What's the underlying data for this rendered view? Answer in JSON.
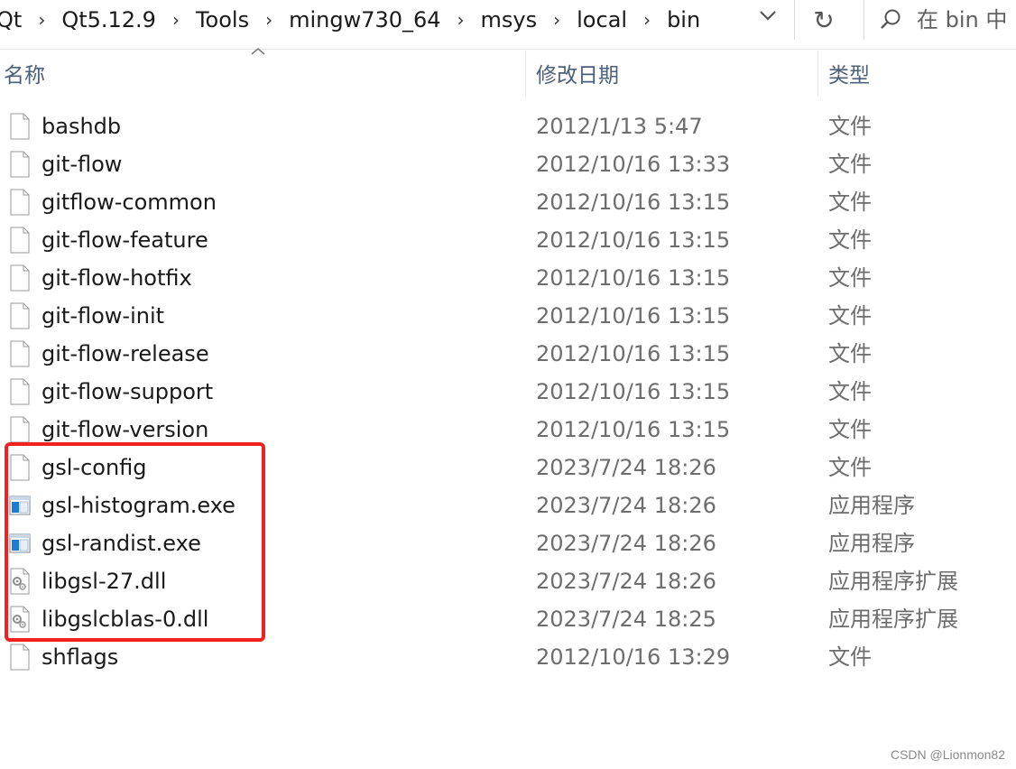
{
  "address_bar": {
    "breadcrumbs": [
      "Qt",
      "Qt5.12.9",
      "Tools",
      "mingw730_64",
      "msys",
      "local",
      "bin"
    ],
    "separator": "›"
  },
  "toolbar": {
    "history_dropdown_icon": "chevron-down-icon",
    "refresh_icon": "refresh-icon",
    "refresh_glyph": "↻"
  },
  "search": {
    "icon": "search-icon",
    "placeholder": "在 bin 中"
  },
  "columns": {
    "name": "名称",
    "date_modified": "修改日期",
    "type": "类型",
    "sort_indicator": "ascending"
  },
  "files": [
    {
      "name": "bashdb",
      "date": "2012/1/13 5:47",
      "type": "文件",
      "icon": "file"
    },
    {
      "name": "git-flow",
      "date": "2012/10/16 13:33",
      "type": "文件",
      "icon": "file"
    },
    {
      "name": "gitflow-common",
      "date": "2012/10/16 13:15",
      "type": "文件",
      "icon": "file"
    },
    {
      "name": "git-flow-feature",
      "date": "2012/10/16 13:15",
      "type": "文件",
      "icon": "file"
    },
    {
      "name": "git-flow-hotfix",
      "date": "2012/10/16 13:15",
      "type": "文件",
      "icon": "file"
    },
    {
      "name": "git-flow-init",
      "date": "2012/10/16 13:15",
      "type": "文件",
      "icon": "file"
    },
    {
      "name": "git-flow-release",
      "date": "2012/10/16 13:15",
      "type": "文件",
      "icon": "file"
    },
    {
      "name": "git-flow-support",
      "date": "2012/10/16 13:15",
      "type": "文件",
      "icon": "file"
    },
    {
      "name": "git-flow-version",
      "date": "2012/10/16 13:15",
      "type": "文件",
      "icon": "file"
    },
    {
      "name": "gsl-config",
      "date": "2023/7/24 18:26",
      "type": "文件",
      "icon": "file"
    },
    {
      "name": "gsl-histogram.exe",
      "date": "2023/7/24 18:26",
      "type": "应用程序",
      "icon": "exe"
    },
    {
      "name": "gsl-randist.exe",
      "date": "2023/7/24 18:26",
      "type": "应用程序",
      "icon": "exe"
    },
    {
      "name": "libgsl-27.dll",
      "date": "2023/7/24 18:26",
      "type": "应用程序扩展",
      "icon": "dll"
    },
    {
      "name": "libgslcblas-0.dll",
      "date": "2023/7/24 18:25",
      "type": "应用程序扩展",
      "icon": "dll"
    },
    {
      "name": "shflags",
      "date": "2012/10/16 13:29",
      "type": "文件",
      "icon": "file"
    }
  ],
  "annotation": {
    "color": "#f0211f",
    "highlighted_files": [
      "gsl-config",
      "gsl-histogram.exe",
      "gsl-randist.exe",
      "libgsl-27.dll",
      "libgslcblas-0.dll"
    ]
  },
  "watermark": "CSDN @Lionmon82"
}
